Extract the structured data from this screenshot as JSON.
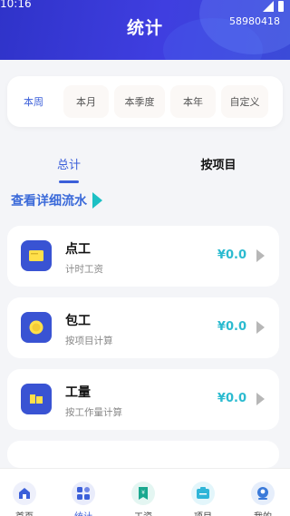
{
  "status_bar": {
    "time": "10:16"
  },
  "header": {
    "title": "统计",
    "user_id": "58980418"
  },
  "periods": [
    {
      "label": "本周",
      "active": true
    },
    {
      "label": "本月",
      "active": false
    },
    {
      "label": "本季度",
      "active": false
    },
    {
      "label": "本年",
      "active": false
    },
    {
      "label": "自定义",
      "active": false
    }
  ],
  "tabs": [
    {
      "label": "总计",
      "active": true
    },
    {
      "label": "按项目",
      "active": false
    }
  ],
  "flow_link": {
    "label": "查看详细流水"
  },
  "items": [
    {
      "name": "点工",
      "desc": "计时工资",
      "amount": "¥0.0",
      "icon": "timesheet-icon"
    },
    {
      "name": "包工",
      "desc": "按项目计算",
      "amount": "¥0.0",
      "icon": "coin-icon"
    },
    {
      "name": "工量",
      "desc": "按工作量计算",
      "amount": "¥0.0",
      "icon": "folder-icon"
    }
  ],
  "bottom_nav": [
    {
      "label": "首页",
      "icon": "home-icon",
      "active": false
    },
    {
      "label": "统计",
      "icon": "grid-icon",
      "active": true
    },
    {
      "label": "工资",
      "icon": "wage-icon",
      "active": false
    },
    {
      "label": "项目",
      "icon": "project-icon",
      "active": false
    },
    {
      "label": "我的",
      "icon": "profile-icon",
      "active": false
    }
  ],
  "colors": {
    "header": "#3a3fd9",
    "accent_blue": "#3b5fd9",
    "amount_teal": "#2bbbd0",
    "arrow_teal": "#1cc0c4",
    "icon_bg": "#3953d3"
  }
}
